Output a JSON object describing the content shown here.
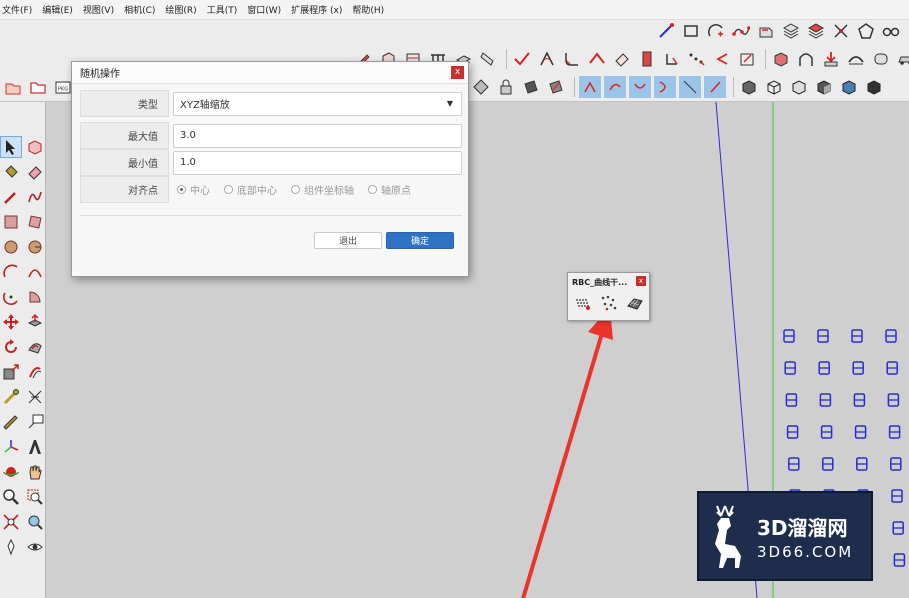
{
  "menu": [
    "文件(F)",
    "编辑(E)",
    "视图(V)",
    "相机(C)",
    "绘图(R)",
    "工具(T)",
    "窗口(W)",
    "扩展程序 (x)",
    "帮助(H)"
  ],
  "dialog": {
    "title": "随机操作",
    "close_label": "x",
    "type_label": "类型",
    "type_value": "XYZ轴缩放",
    "max_label": "最大值",
    "max_value": "3.0",
    "min_label": "最小值",
    "min_value": "1.0",
    "align_label": "对齐点",
    "align_options": [
      {
        "label": "中心",
        "selected": true
      },
      {
        "label": "底部中心",
        "selected": false
      },
      {
        "label": "组件坐标轴",
        "selected": false
      },
      {
        "label": "轴原点",
        "selected": false
      }
    ],
    "exit_label": "退出",
    "ok_label": "确定"
  },
  "mini_toolbar": {
    "title": "RBC_曲线干...",
    "close_label": "x"
  },
  "watermark": {
    "main": "3D溜溜网",
    "sub": "3D66.COM"
  },
  "colors": {
    "blue_axis": "#2b2bd6",
    "green_axis": "#3fbf3f",
    "red_arrow": "#e8342c",
    "ok_button": "#2f72c2",
    "close_button": "#c9302c",
    "watermark_bg": "#1f2d4d"
  },
  "small_label": "PKG"
}
